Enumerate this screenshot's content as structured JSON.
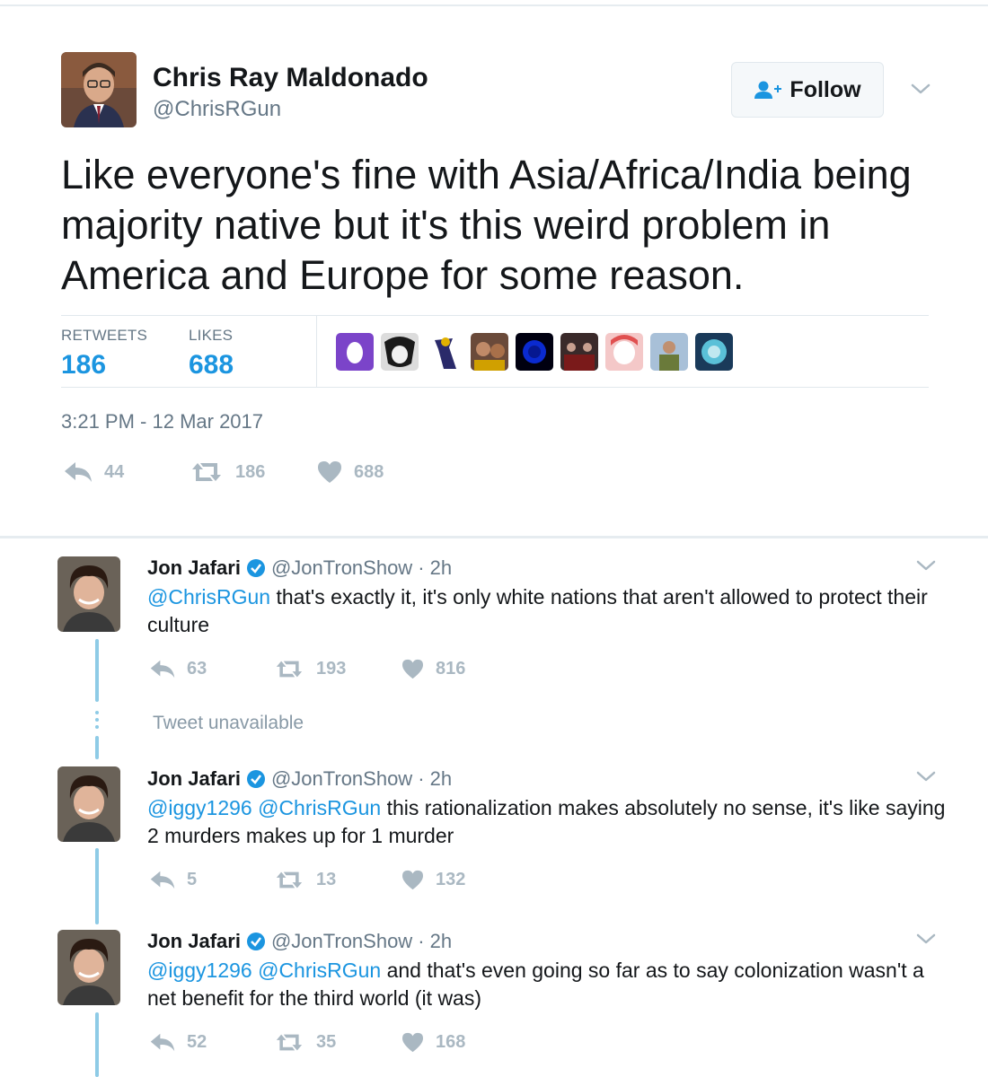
{
  "main": {
    "name": "Chris Ray Maldonado",
    "handle": "@ChrisRGun",
    "follow_label": "Follow",
    "text": "Like everyone's fine with Asia/Africa/India being majority native but it's this weird problem in America and Europe for some reason.",
    "retweets_label": "RETWEETS",
    "retweets": "186",
    "likes_label": "LIKES",
    "likes": "688",
    "timestamp": "3:21 PM - 12 Mar 2017",
    "actions": {
      "replies": "44",
      "retweets": "186",
      "likes": "688"
    },
    "liker_colors": [
      "#7b44c9",
      "#c8c8c8",
      "#f2f2f2",
      "#b07a52",
      "#0a1a8a",
      "#5a4038",
      "#e89aa0",
      "#6a8a4a",
      "#4aa8c8"
    ]
  },
  "replies": [
    {
      "name": "Jon Jafari",
      "handle": "@JonTronShow",
      "time": "· 2h",
      "mentions": "@ChrisRGun",
      "body": " that's exactly it, it's only white nations that aren't allowed to protect their culture",
      "actions": {
        "replies": "63",
        "retweets": "193",
        "likes": "816"
      }
    },
    {
      "name": "Jon Jafari",
      "handle": "@JonTronShow",
      "time": "· 2h",
      "mentions": "@iggy1296 @ChrisRGun",
      "body": " this rationalization makes absolutely no sense, it's like saying 2 murders makes up for 1 murder",
      "actions": {
        "replies": "5",
        "retweets": "13",
        "likes": "132"
      }
    },
    {
      "name": "Jon Jafari",
      "handle": "@JonTronShow",
      "time": "· 2h",
      "mentions": "@iggy1296 @ChrisRGun",
      "body": " and that's even going so far as to say colonization wasn't a net benefit for the third world (it was)",
      "actions": {
        "replies": "52",
        "retweets": "35",
        "likes": "168"
      }
    }
  ],
  "tweet_unavailable": "Tweet unavailable",
  "colors": {
    "accent": "#1b95e0",
    "muted": "#657786",
    "icon": "#aab8c2",
    "thread": "#8ecbe6"
  },
  "icons": [
    "reply-icon",
    "retweet-icon",
    "heart-icon",
    "verified-badge-icon",
    "add-user-icon",
    "chevron-down-icon"
  ]
}
